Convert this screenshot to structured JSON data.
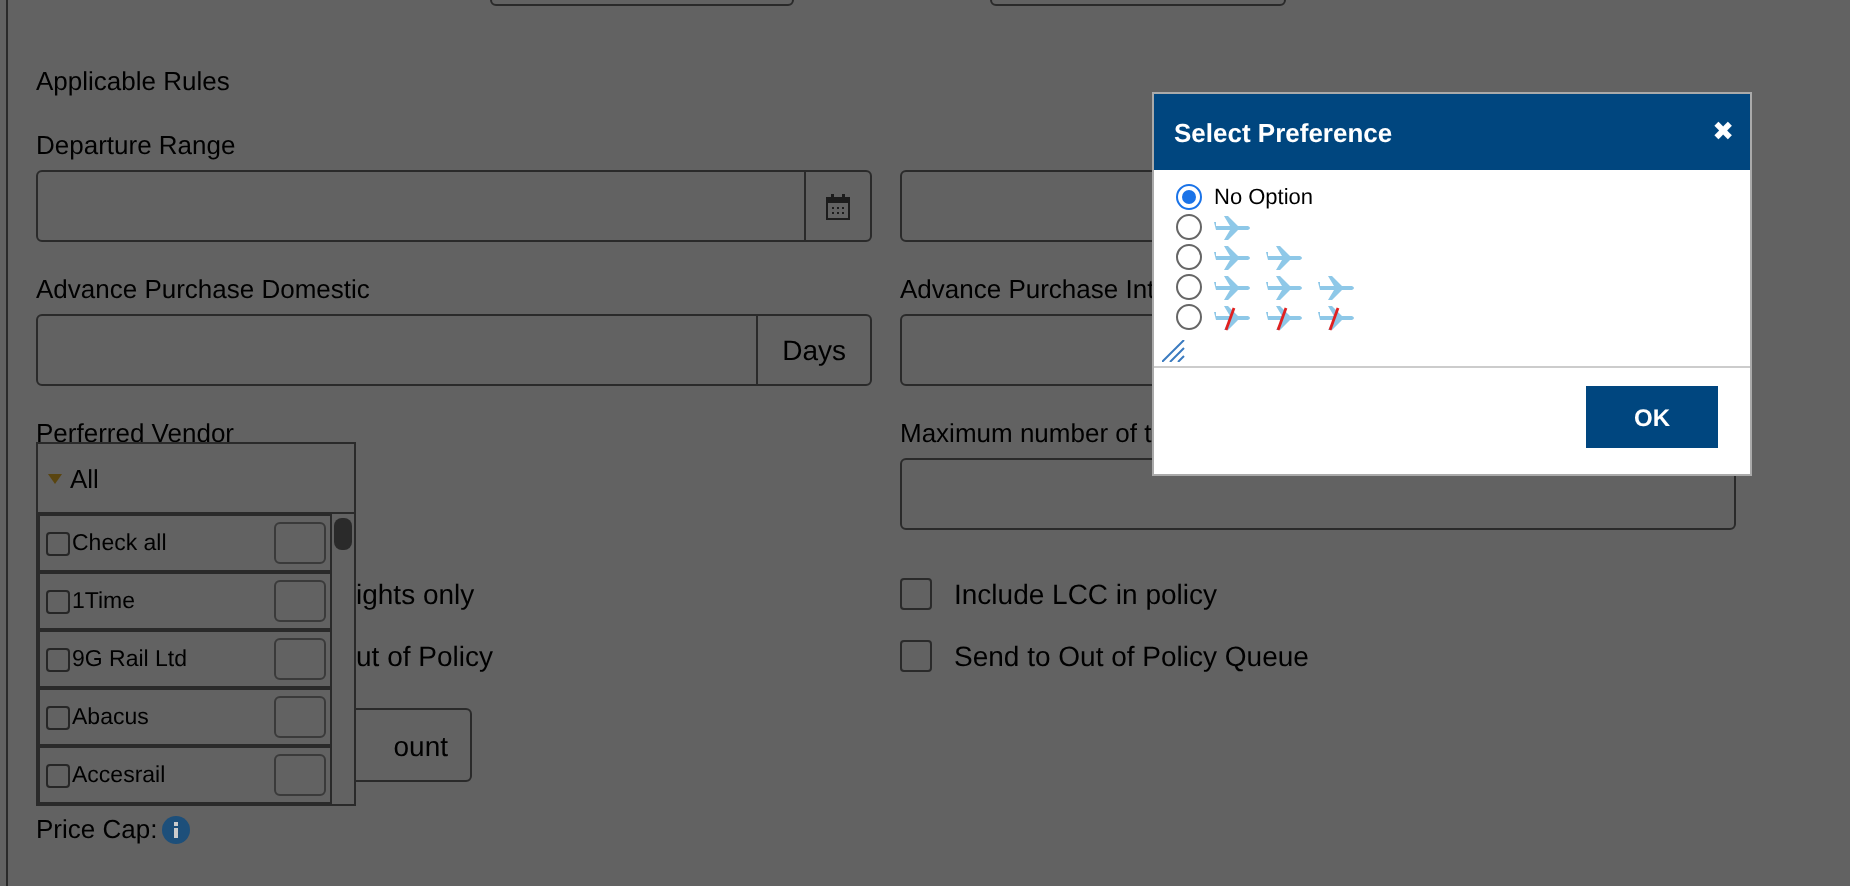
{
  "form": {
    "section_title": "Applicable Rules",
    "departure_range": {
      "label": "Departure Range"
    },
    "advance_purchase_domestic": {
      "label": "Advance Purchase Domestic",
      "unit": "Days"
    },
    "advance_purchase_international": {
      "label": "Advance Purchase Int"
    },
    "preferred_vendor": {
      "label": "Perferred Vendor",
      "value": "All"
    },
    "maximum_number": {
      "label": "Maximum number of t"
    },
    "left_options": [
      {
        "label": "ights only"
      },
      {
        "label": "ut of Policy"
      }
    ],
    "right_options": [
      {
        "label": "Include LCC in policy",
        "checked": false
      },
      {
        "label": "Send to Out of Policy Queue",
        "checked": false
      }
    ],
    "account_button": "ount",
    "price_cap": "Price Cap:"
  },
  "vendor_dropdown": {
    "items": [
      {
        "label": "Check all",
        "checked": false
      },
      {
        "label": "1Time",
        "checked": false
      },
      {
        "label": "9G Rail Ltd",
        "checked": false
      },
      {
        "label": "Abacus",
        "checked": false
      },
      {
        "label": "Accesrail",
        "checked": false
      }
    ]
  },
  "dialog": {
    "title": "Select Preference",
    "close": "✖",
    "options": [
      {
        "kind": "text",
        "label": "No Option",
        "selected": true
      },
      {
        "kind": "icons",
        "icons": [
          {
            "crossed": false
          }
        ],
        "selected": false
      },
      {
        "kind": "icons",
        "icons": [
          {
            "crossed": false
          },
          {
            "crossed": false
          }
        ],
        "selected": false
      },
      {
        "kind": "icons",
        "icons": [
          {
            "crossed": false
          },
          {
            "crossed": false
          },
          {
            "crossed": false
          }
        ],
        "selected": false
      },
      {
        "kind": "icons",
        "icons": [
          {
            "crossed": true
          },
          {
            "crossed": true
          },
          {
            "crossed": true
          }
        ],
        "selected": false
      }
    ],
    "ok": "OK"
  }
}
